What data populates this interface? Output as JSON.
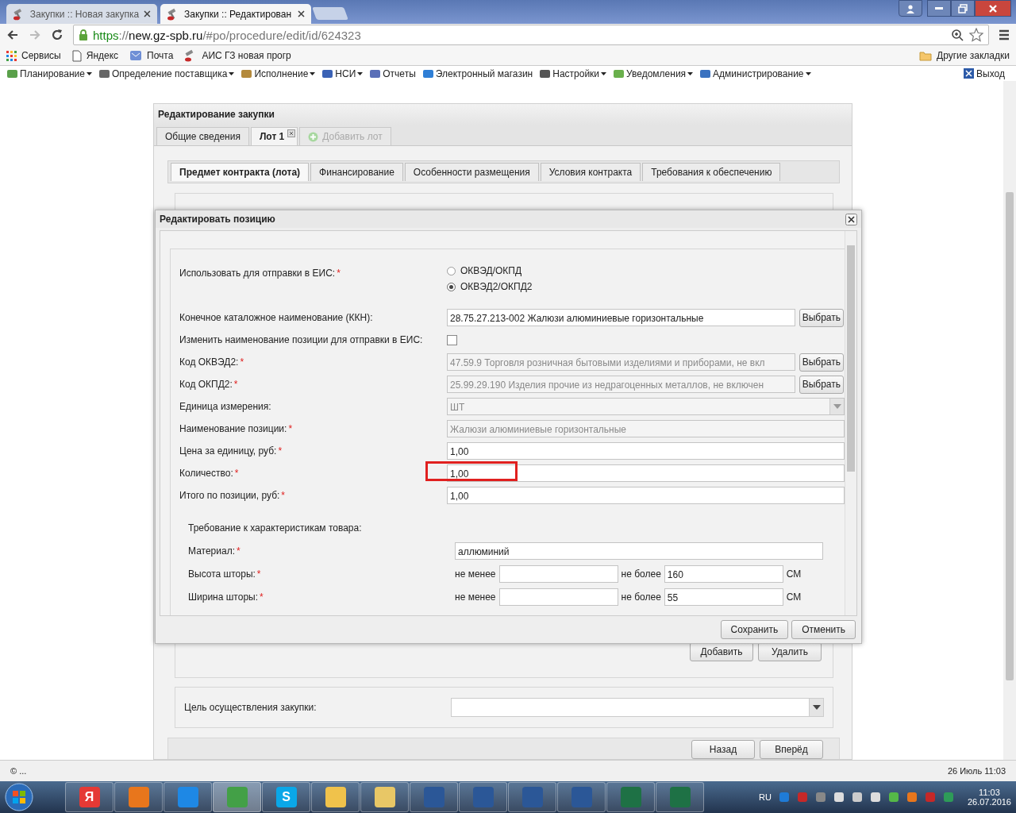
{
  "browser": {
    "tabs": [
      {
        "title": "Закупки :: Новая закупка",
        "selected": false
      },
      {
        "title": "Закупки :: Редактирован",
        "selected": true
      }
    ],
    "url": {
      "scheme": "https",
      "rest": "://",
      "host": "new.gz-spb.ru",
      "path": "/#po/procedure/edit/id/624323"
    },
    "bookmarks": [
      {
        "kind": "apps",
        "label": "Сервисы"
      },
      {
        "kind": "page",
        "label": "Яндекс"
      },
      {
        "kind": "mail",
        "label": "Почта"
      },
      {
        "kind": "tool",
        "label": "АИС ГЗ новая прогр"
      }
    ],
    "other_bookmarks": "Другие закладки"
  },
  "app_menu": {
    "items": [
      {
        "label": "Планирование",
        "dropdown": true
      },
      {
        "label": "Определение поставщика",
        "dropdown": true
      },
      {
        "label": "Исполнение",
        "dropdown": true
      },
      {
        "label": "НСИ",
        "dropdown": true
      },
      {
        "label": "Отчеты",
        "dropdown": false
      },
      {
        "label": "Электронный магазин",
        "dropdown": false
      },
      {
        "label": "Настройки",
        "dropdown": true
      },
      {
        "label": "Уведомления",
        "dropdown": true
      },
      {
        "label": "Администрирование",
        "dropdown": true
      }
    ],
    "exit": "Выход"
  },
  "main": {
    "title": "Редактирование закупки",
    "tabs": [
      {
        "label": "Общие сведения",
        "selected": false,
        "kind": "plain"
      },
      {
        "label": "Лот 1",
        "selected": true,
        "kind": "closable"
      },
      {
        "label": "Добавить лот",
        "selected": false,
        "kind": "add"
      }
    ],
    "subtabs": [
      {
        "label": "Предмет контракта (лота)",
        "selected": true
      },
      {
        "label": "Финансирование",
        "selected": false
      },
      {
        "label": "Особенности размещения",
        "selected": false
      },
      {
        "label": "Условия контракта",
        "selected": false
      },
      {
        "label": "Требования к обеспечению",
        "selected": false
      }
    ],
    "list_buttons": [
      "Добавить",
      "Удалить"
    ],
    "purpose_label": "Цель осуществления закупки:",
    "nav_buttons": [
      "Назад",
      "Вперёд"
    ]
  },
  "dialog": {
    "title": "Редактировать позицию",
    "rows": [
      {
        "kind": "radio",
        "label": "Использовать для отправки в ЕИС:",
        "required_mark": "*",
        "options": [
          {
            "label": "ОКВЭД/ОКПД",
            "selected": false
          },
          {
            "label": "ОКВЭД2/ОКПД2",
            "selected": true
          }
        ]
      },
      {
        "kind": "lookup",
        "label": "Конечное каталожное наименование (ККН):",
        "value": "28.75.27.213-002 Жалюзи алюминиевые горизонтальные",
        "disabled": false,
        "button": "Выбрать"
      },
      {
        "kind": "checkbox",
        "label": "Изменить наименование позиции для отправки в ЕИС:",
        "checked": false
      },
      {
        "kind": "lookup",
        "label": "Код ОКВЭД2:",
        "required_mark": "*",
        "value": "47.59.9 Торговля розничная бытовыми изделиями и приборами, не вкл",
        "disabled": true,
        "button": "Выбрать"
      },
      {
        "kind": "lookup",
        "label": "Код ОКПД2:",
        "required_mark": "*",
        "value": "25.99.29.190 Изделия прочие из недрагоценных металлов, не включен",
        "disabled": true,
        "button": "Выбрать"
      },
      {
        "kind": "select",
        "label": "Единица измерения:",
        "value": "ШТ",
        "disabled": true
      },
      {
        "kind": "text",
        "label": "Наименование позиции:",
        "required_mark": "*",
        "value": "Жалюзи алюминиевые горизонтальные",
        "disabled": true,
        "highlighted": false
      },
      {
        "kind": "text",
        "label": "Цена за единицу, руб:",
        "required_mark": "*",
        "value": "1,00",
        "disabled": false,
        "highlighted": false
      },
      {
        "kind": "text",
        "label": "Количество:",
        "required_mark": "*",
        "value": "1,00",
        "disabled": false,
        "highlighted": true
      },
      {
        "kind": "text",
        "label": "Итого по позиции, руб:",
        "required_mark": "*",
        "value": "1,00",
        "disabled": false,
        "highlighted": false
      }
    ],
    "section": {
      "title": "Требование к характеристикам товара:",
      "rows": [
        {
          "kind": "text",
          "label": "Материал:",
          "required_mark": "*",
          "value": "аллюминий"
        },
        {
          "kind": "range",
          "label": "Высота шторы:",
          "required_mark": "*",
          "min_label": "не менее",
          "min": "",
          "max_label": "не более",
          "max": "160",
          "unit": "СМ"
        },
        {
          "kind": "range",
          "label": "Ширина шторы:",
          "required_mark": "*",
          "min_label": "не менее",
          "min": "",
          "max_label": "не более",
          "max": "55",
          "unit": "СМ"
        }
      ]
    },
    "buttons": [
      "Сохранить",
      "Отменить"
    ]
  },
  "status_bar": {
    "left": "© ...",
    "right": "26 Июль 11:03"
  },
  "taskbar": {
    "apps": [
      {
        "kind": "yandex",
        "glyph": "Я"
      },
      {
        "kind": "firefox"
      },
      {
        "kind": "ie"
      },
      {
        "kind": "chrome",
        "selected": true
      },
      {
        "kind": "skype",
        "glyph": "S"
      },
      {
        "kind": "mail"
      },
      {
        "kind": "folder"
      },
      {
        "kind": "word"
      },
      {
        "kind": "word"
      },
      {
        "kind": "word"
      },
      {
        "kind": "word"
      },
      {
        "kind": "excel"
      },
      {
        "kind": "excel"
      }
    ],
    "language": "RU",
    "time": "11:03",
    "date": "26.07.2016"
  }
}
